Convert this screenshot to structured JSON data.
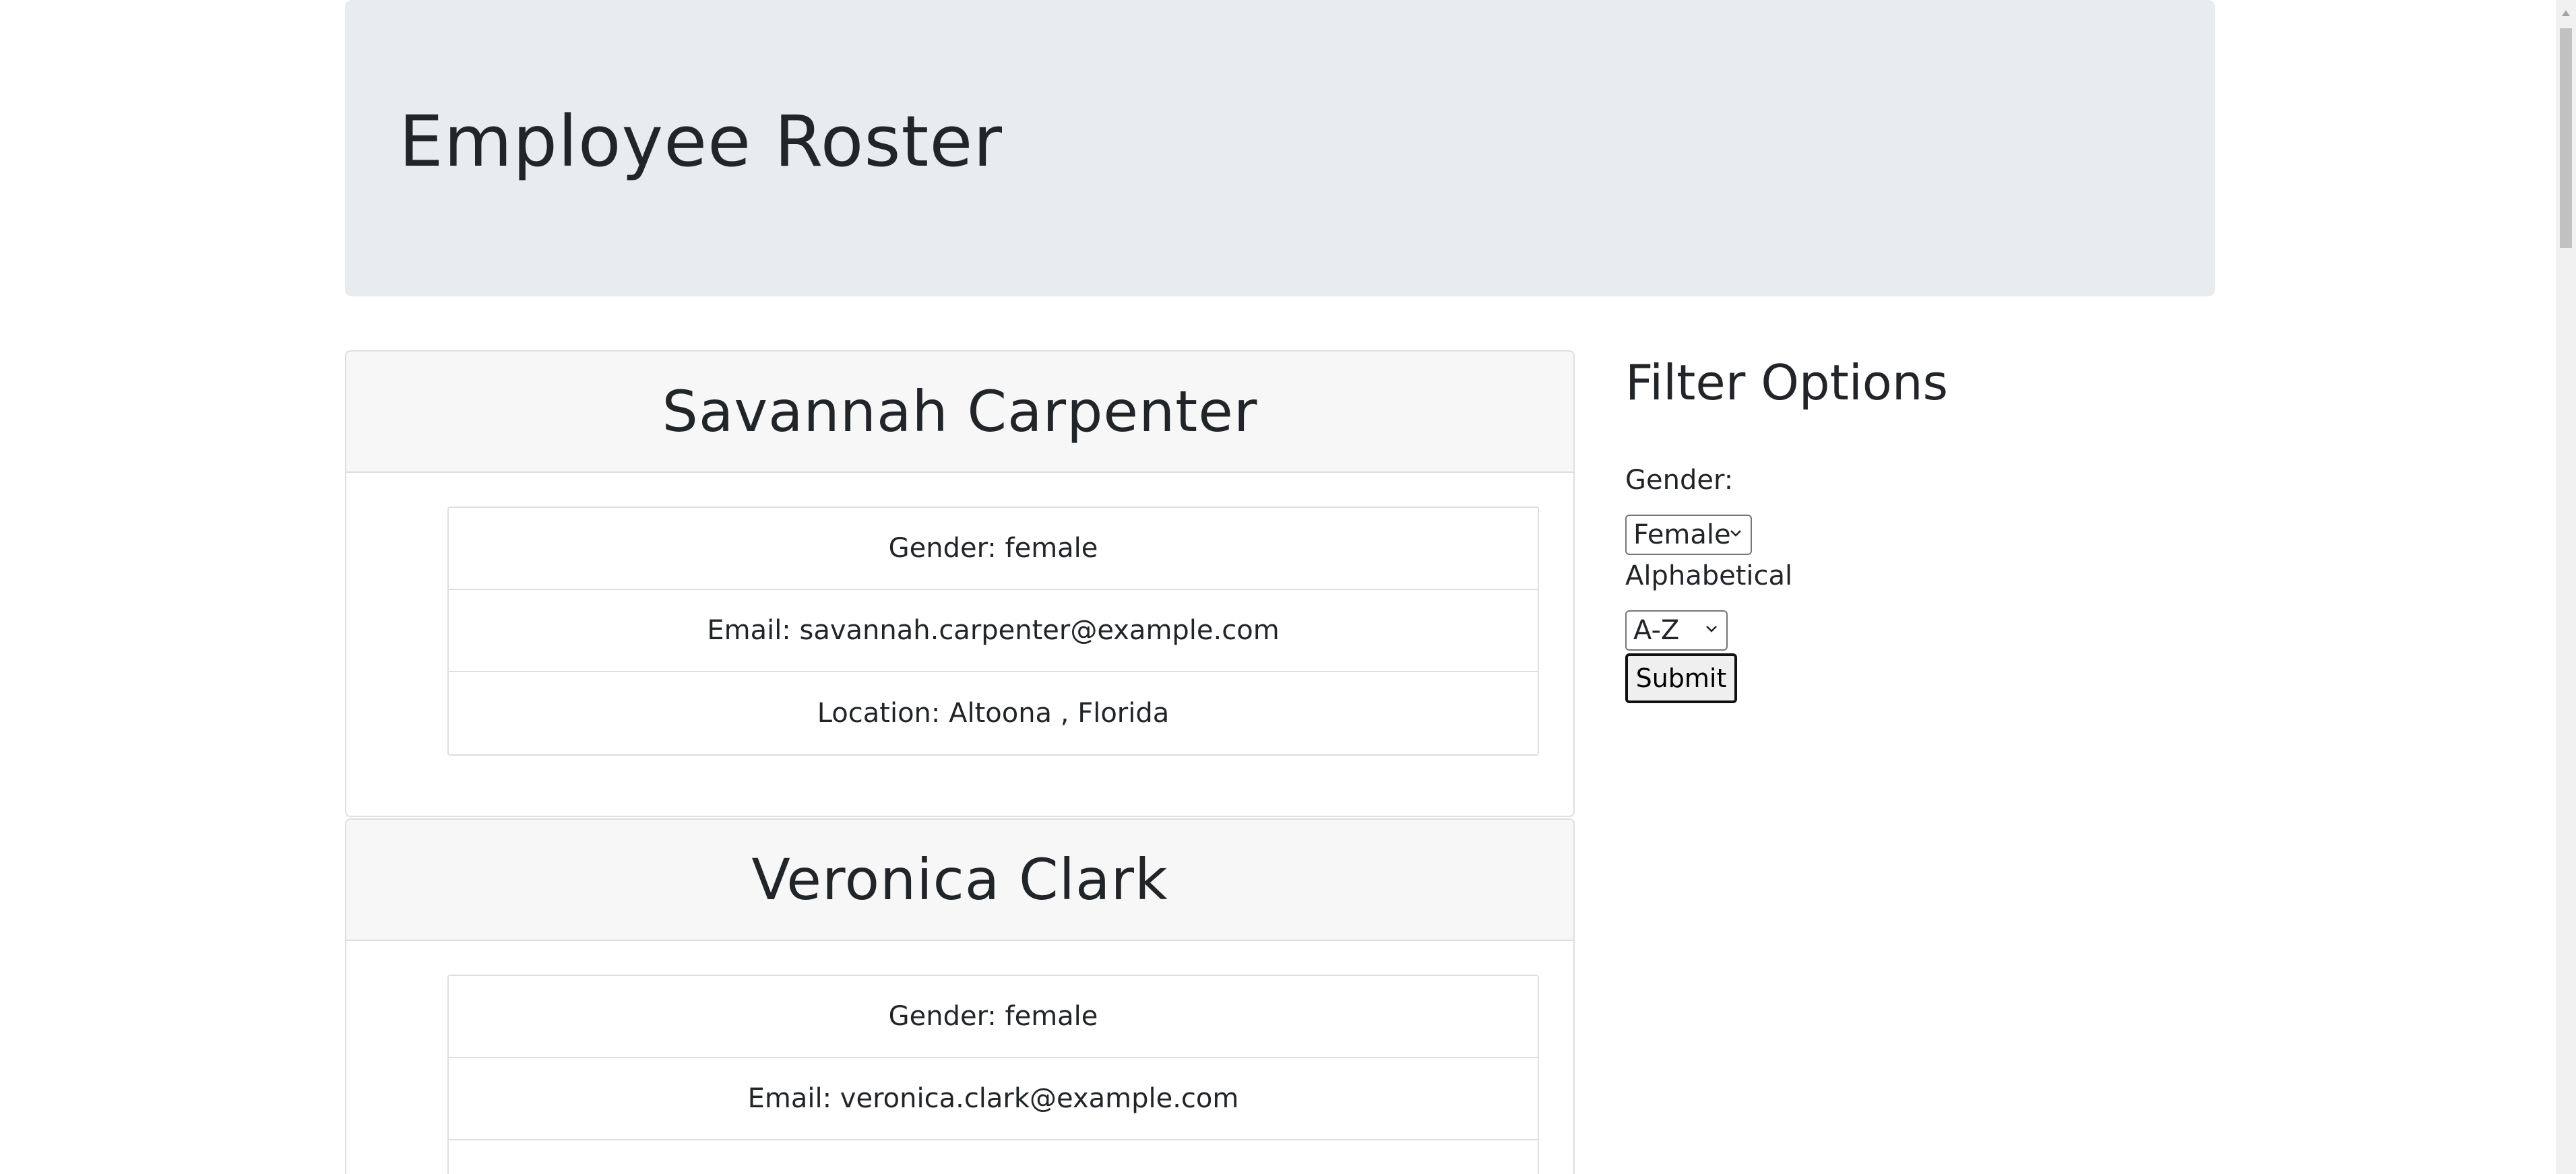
{
  "header": {
    "title": "Employee Roster"
  },
  "employees": [
    {
      "name": "Savannah Carpenter",
      "gender": "Gender: female",
      "email": "Email: savannah.carpenter@example.com",
      "location": "Location: Altoona , Florida"
    },
    {
      "name": "Veronica Clark",
      "gender": "Gender: female",
      "email": "Email: veronica.clark@example.com"
    }
  ],
  "filters": {
    "title": "Filter Options",
    "gender_label": "Gender:",
    "gender_selected": "Female",
    "alpha_label": "Alphabetical",
    "alpha_selected": "A-Z",
    "submit_label": "Submit"
  },
  "icons": {
    "select_arrow": "chevron-down-icon",
    "scroll_up": "triangle-up-icon"
  },
  "colors": {
    "header_bg": "#e9ecef",
    "card_header_bg": "#f7f7f7",
    "border": "#dfdfdf",
    "text": "#212529"
  }
}
